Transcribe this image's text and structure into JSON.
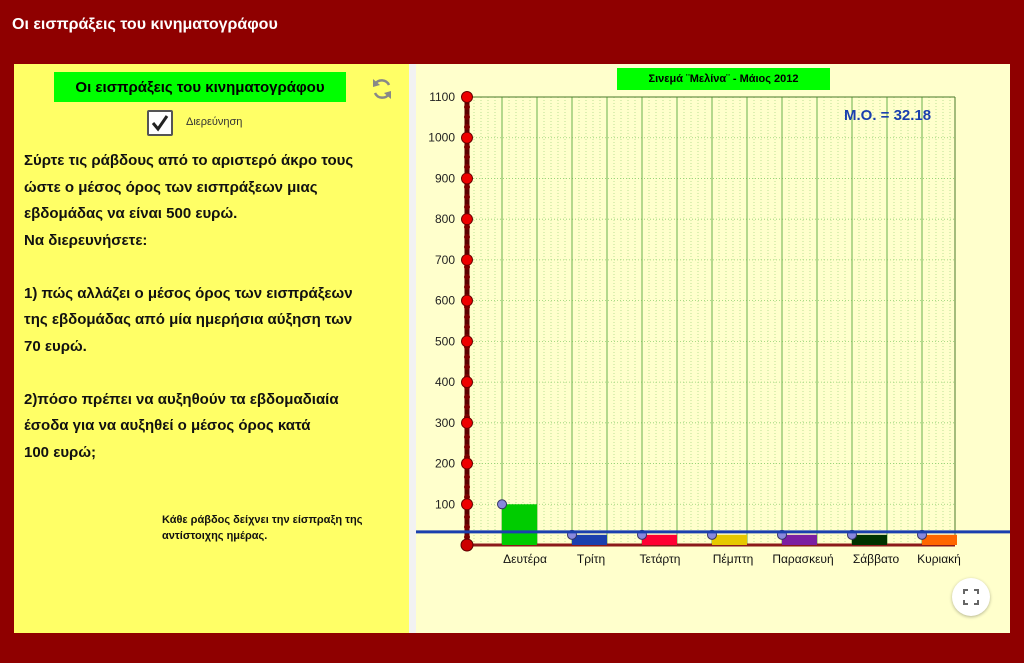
{
  "window": {
    "title": "Οι εισπράξεις του κινηματογράφου"
  },
  "panel": {
    "title": "Οι εισπράξεις του κινηματογράφου",
    "checkbox_label": "Διερεύνηση",
    "checkbox_checked": true,
    "instructions": [
      "Σύρτε τις ράβδους από το αριστερό άκρο τους",
      "ώστε ο μέσος όρος των εισπράξεων μιας",
      "εβδομάδας να είναι 500 ευρώ.",
      "Να διερευνήσετε:",
      "",
      "1) πώς αλλάζει ο μέσος όρος των εισπράξεων",
      "της εβδομάδας από μία ημερήσια αύξηση των",
      "70 ευρώ.",
      "",
      "2)πόσο πρέπει να αυξηθούν τα εβδομαδιαία",
      "έσοδα για να αυξηθεί ο μέσος όρος κατά",
      "100 ευρώ;"
    ],
    "note_line1": "Κάθε ράβδος δείχνει την  είσπραξη της",
    "note_line2": "αντίστοιχης ημέρας."
  },
  "chart_data": {
    "type": "bar",
    "title": "Σινεμά ¨Μελίνα¨  -  Μάιος 2012",
    "categories": [
      "Δευτέρα",
      "Τρίτη",
      "Τετάρτη",
      "Πέμπτη",
      "Παρασκευή",
      "Σάββατο",
      "Κυριακή"
    ],
    "values": [
      100,
      25,
      25,
      25,
      25,
      25,
      25
    ],
    "colors": [
      "#00cc00",
      "#1a3fae",
      "#ff0033",
      "#e6c800",
      "#7b1fa2",
      "#003300",
      "#ff6600"
    ],
    "ylim": [
      0,
      1100
    ],
    "yticks": [
      100,
      200,
      300,
      400,
      500,
      600,
      700,
      800,
      900,
      1000,
      1100
    ],
    "mean_label": "Μ.Ο. = 32.18",
    "mean_value": 32.18,
    "mean_line_color": "#1a3fae",
    "grid": true
  },
  "colors": {
    "frame": "#8f0000",
    "left_panel": "#ffff66",
    "right_panel": "#ffffcc",
    "highlight": "#00ff00"
  }
}
